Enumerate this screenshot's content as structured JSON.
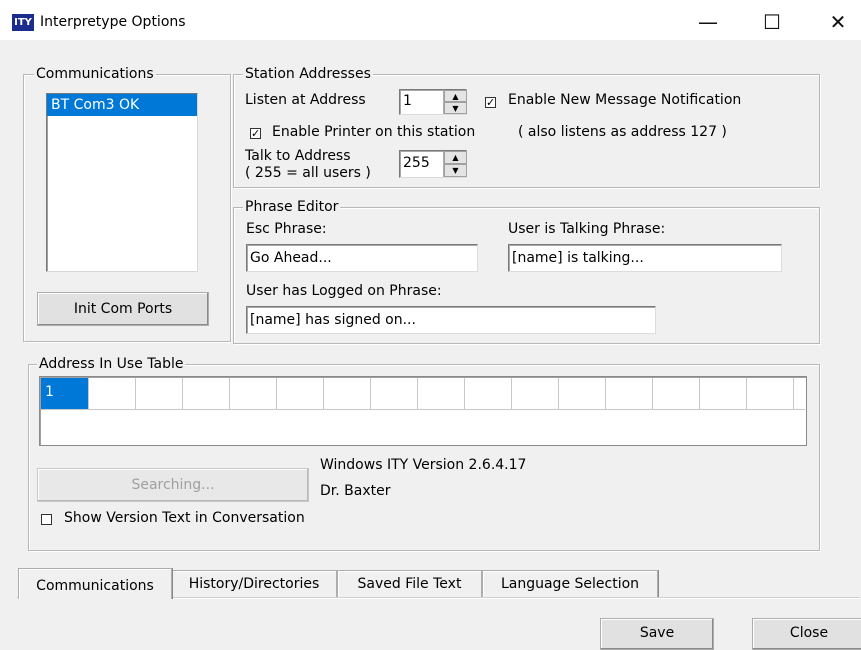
{
  "window": {
    "icon_text": "ITY",
    "title": "Interpretype Options",
    "minimize_glyph": "—",
    "maximize_glyph": "☐",
    "close_glyph": "✕"
  },
  "communications": {
    "group_title": "Communications",
    "ports": [
      "BT Com3 OK"
    ],
    "selected_port": "BT Com3 OK",
    "init_button": "Init Com Ports"
  },
  "station": {
    "group_title": "Station Addresses",
    "listen_label": "Listen at Address",
    "listen_value": "1",
    "notify_label": "Enable New Message Notification",
    "notify_checked": true,
    "printer_label": "Enable Printer on this station",
    "printer_note": "( also listens as address 127 )",
    "printer_checked": true,
    "talk_label_line1": "Talk to Address",
    "talk_label_line2": "( 255 = all users )",
    "talk_value": "255"
  },
  "phrase_editor": {
    "group_title": "Phrase Editor",
    "esc_label": "Esc Phrase:",
    "esc_value": "Go Ahead...",
    "talking_label": "User is Talking Phrase:",
    "talking_value": "[name] is talking...",
    "logged_label": "User has Logged on Phrase:",
    "logged_value": "[name] has signed on..."
  },
  "address_table": {
    "group_title": "Address In Use Table",
    "cells": [
      "1",
      "",
      "",
      "",
      "",
      "",
      "",
      "",
      "",
      "",
      "",
      "",
      "",
      "",
      "",
      "",
      ""
    ],
    "searching_button": "Searching...",
    "version_text": "Windows ITY Version 2.6.4.17",
    "author_text": "Dr. Baxter",
    "show_version_label": "Show Version Text in Conversation",
    "show_version_checked": false
  },
  "tabs": [
    "Communications",
    "History/Directories",
    "Saved File Text",
    "Language Selection"
  ],
  "active_tab": "Communications",
  "footer": {
    "save_button": "Save",
    "close_button": "Close"
  },
  "colors": {
    "selection": "#0078d7",
    "dialog_bg": "#f0f0f0",
    "icon_bg": "#1a2c8c"
  }
}
